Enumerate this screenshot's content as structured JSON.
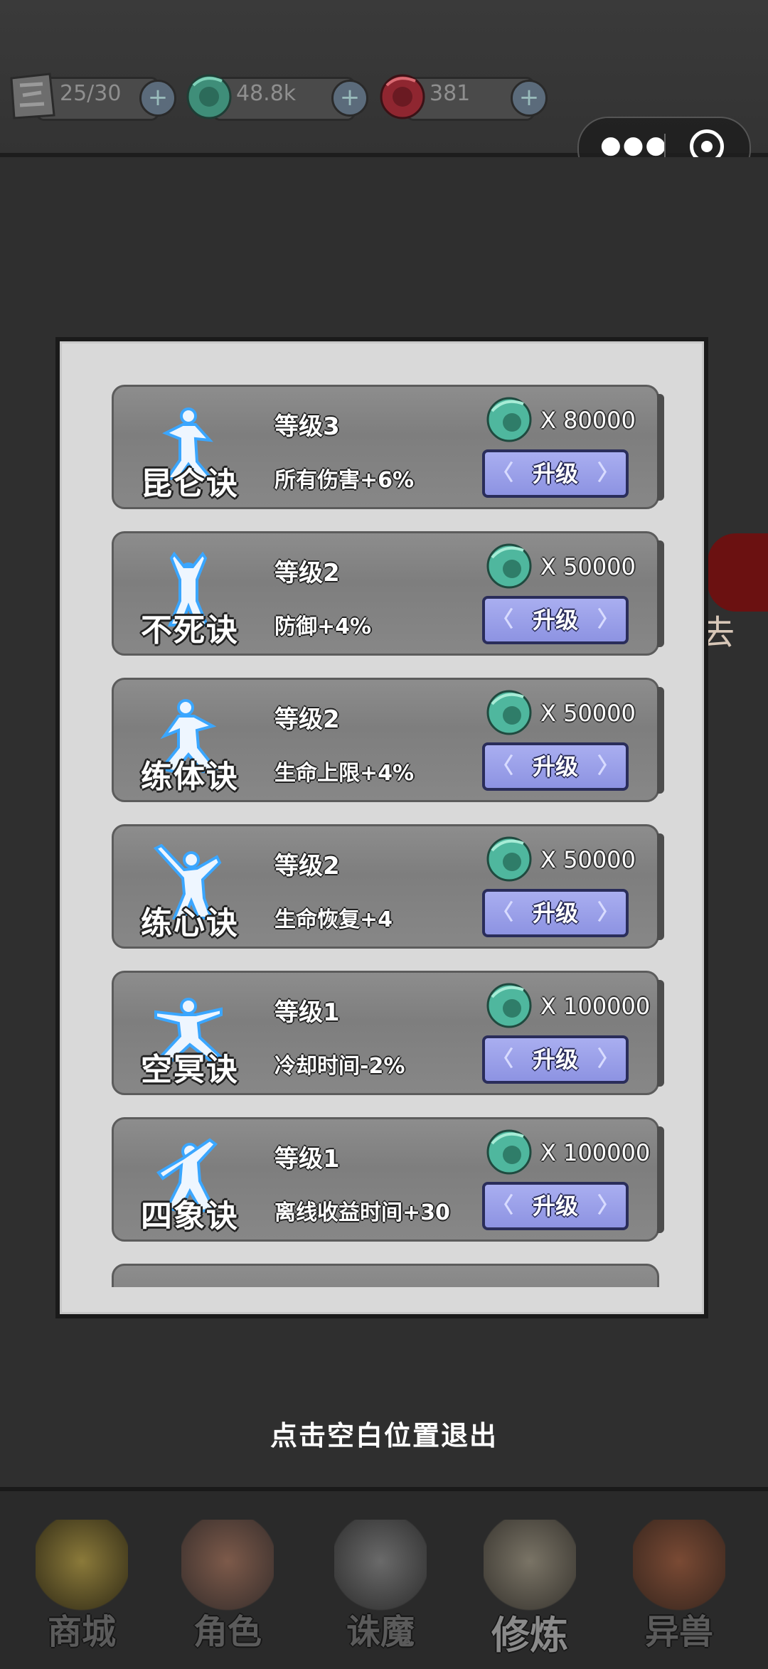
{
  "resources": [
    {
      "icon": "stamina-icon",
      "value": "25/30"
    },
    {
      "icon": "jade-dragon-icon",
      "value": "48.8k"
    },
    {
      "icon": "red-dragon-icon",
      "value": "381"
    }
  ],
  "background_text": "去",
  "skills": [
    {
      "name": "昆仑诀",
      "level": "等级3",
      "effect": "所有伤害+6%",
      "cost": "X 80000",
      "button": "升级"
    },
    {
      "name": "不死诀",
      "level": "等级2",
      "effect": "防御+4%",
      "cost": "X 50000",
      "button": "升级"
    },
    {
      "name": "练体诀",
      "level": "等级2",
      "effect": "生命上限+4%",
      "cost": "X 50000",
      "button": "升级"
    },
    {
      "name": "练心诀",
      "level": "等级2",
      "effect": "生命恢复+4",
      "cost": "X 50000",
      "button": "升级"
    },
    {
      "name": "空冥诀",
      "level": "等级1",
      "effect": "冷却时间-2%",
      "cost": "X 100000",
      "button": "升级"
    },
    {
      "name": "四象诀",
      "level": "等级1",
      "effect": "离线收益时间+30",
      "cost": "X 100000",
      "button": "升级"
    }
  ],
  "exit_hint": "点击空白位置退出",
  "nav": [
    {
      "label": "商城",
      "icon": "shop-icon"
    },
    {
      "label": "角色",
      "icon": "character-icon"
    },
    {
      "label": "诛魔",
      "icon": "sword-icon"
    },
    {
      "label": "修炼",
      "icon": "scroll-icon"
    },
    {
      "label": "异兽",
      "icon": "beast-icon"
    }
  ],
  "colors": {
    "accent_button": "#9ba0ea",
    "gem": "#4fb79e",
    "red_gem": "#b5303a"
  }
}
